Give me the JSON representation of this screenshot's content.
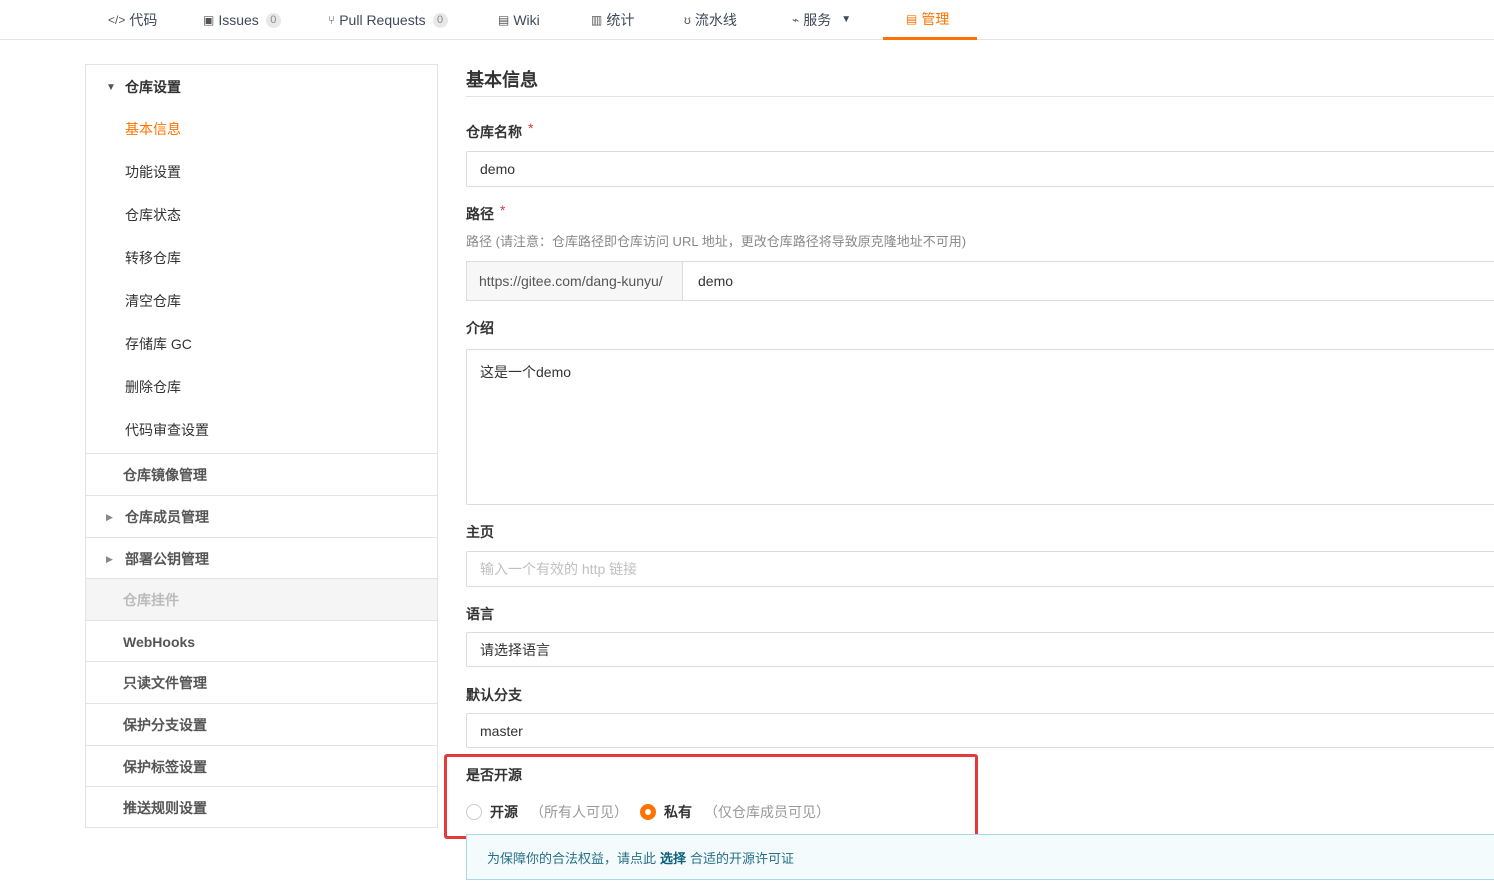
{
  "tabs": [
    {
      "icon": "code-icon",
      "glyph": "</>",
      "label": "代码"
    },
    {
      "icon": "issues-icon",
      "glyph": "▣",
      "label": "Issues",
      "count": "0"
    },
    {
      "icon": "pull-request-icon",
      "glyph": "⑂",
      "label": "Pull Requests",
      "count": "0"
    },
    {
      "icon": "wiki-icon",
      "glyph": "▤",
      "label": "Wiki"
    },
    {
      "icon": "stats-icon",
      "glyph": "▥",
      "label": "统计"
    },
    {
      "icon": "pipeline-icon",
      "glyph": "ʊ",
      "label": "流水线"
    },
    {
      "icon": "service-icon",
      "glyph": "⌁",
      "label": "服务",
      "caret": "▼"
    },
    {
      "icon": "manage-icon",
      "glyph": "▤",
      "label": "管理"
    }
  ],
  "accent_color": "#fe7300",
  "sidebar": {
    "repo_settings": {
      "label": "仓库设置",
      "items": [
        "基本信息",
        "功能设置",
        "仓库状态",
        "转移仓库",
        "清空仓库",
        "存储库 GC",
        "删除仓库",
        "代码审查设置"
      ]
    },
    "sections": [
      "仓库镜像管理",
      "仓库成员管理",
      "部署公钥管理",
      "仓库挂件",
      "WebHooks",
      "只读文件管理",
      "保护分支设置",
      "保护标签设置",
      "推送规则设置"
    ]
  },
  "main": {
    "title": "基本信息",
    "name_label": "仓库名称",
    "required_mark": "*",
    "name_value": "demo",
    "path_label": "路径",
    "path_hint": "路径 (请注意：仓库路径即仓库访问 URL 地址，更改仓库路径将导致原克隆地址不可用)",
    "path_prefix": "https://gitee.com/dang-kunyu/",
    "path_value": "demo",
    "intro_label": "介绍",
    "intro_value": "这是一个demo",
    "homepage_label": "主页",
    "homepage_placeholder": "输入一个有效的 http 链接",
    "language_label": "语言",
    "language_value": "请选择语言",
    "branch_label": "默认分支",
    "branch_value": "master",
    "open_label": "是否开源",
    "radio_public_label": "开源",
    "radio_public_desc": "（所有人可见）",
    "radio_private_label": "私有",
    "radio_private_desc": "（仅仓库成员可见）",
    "notice_prefix": "为保障你的合法权益，请点此",
    "notice_link": "选择",
    "notice_suffix": "合适的开源许可证"
  }
}
